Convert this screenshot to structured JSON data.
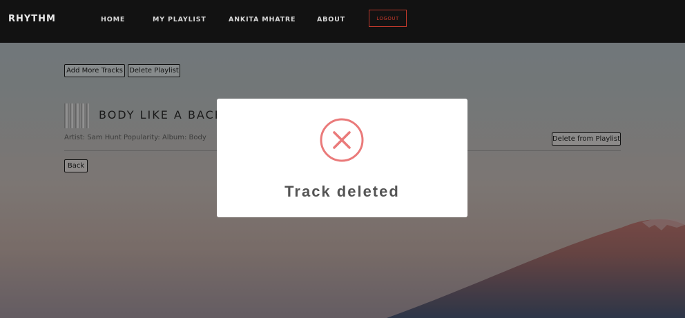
{
  "nav": {
    "brand": "RHYTHM",
    "items": [
      {
        "label": "HOME"
      },
      {
        "label": "MY PLAYLIST"
      },
      {
        "label": "ANKITA MHATRE"
      },
      {
        "label": "ABOUT"
      }
    ],
    "logout_label": "LOGOUT",
    "logout_color": "#c0392b"
  },
  "playlist": {
    "add_tracks_label": "Add More Tracks",
    "delete_playlist_label": "Delete Playlist",
    "track": {
      "title": "BODY LIKE A BACK",
      "meta": "Artist: Sam Hunt Popularity: Album: Body",
      "delete_label": "Delete from Playlist"
    },
    "back_label": "Back"
  },
  "modal": {
    "icon": "error-x-icon",
    "icon_color": "#ea7a7a",
    "title": "Track deleted"
  }
}
